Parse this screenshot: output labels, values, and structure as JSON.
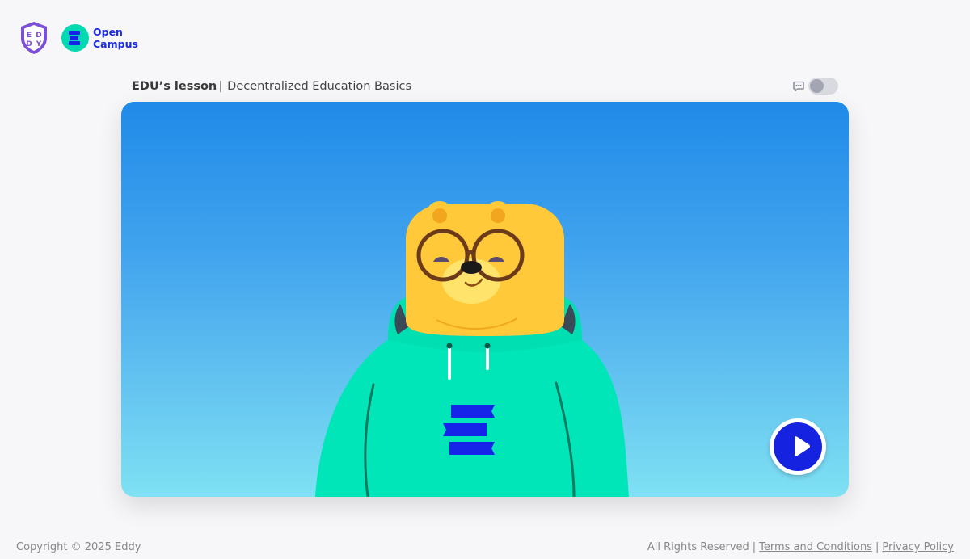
{
  "header": {
    "brand_logo_icon": "eddy-shield-icon",
    "partner_logo_icon": "open-campus-icon",
    "partner_name_line1": "Open",
    "partner_name_line2": "Campus",
    "brand_colors": {
      "purple": "#7b4fd6",
      "teal": "#00d9b1",
      "blue": "#1a2bd8"
    }
  },
  "lesson": {
    "owner_label": "EDU’s lesson",
    "separator": "|",
    "title": "Decentralized Education Basics"
  },
  "controls": {
    "captions_icon": "chat-bubble-icon",
    "captions_toggle_on": false
  },
  "video": {
    "background_top": "#1f8ae8",
    "background_bottom": "#7fe1f3",
    "character": "bear-mascot-in-green-hoodie",
    "play_icon": "play-icon",
    "play_button_color": "#1522e0"
  },
  "footer": {
    "copyright": "Copyright © 2025 Eddy",
    "rights": "All Rights Reserved",
    "separator": "|",
    "terms_label": "Terms and Conditions",
    "privacy_label": "Privacy Policy"
  }
}
